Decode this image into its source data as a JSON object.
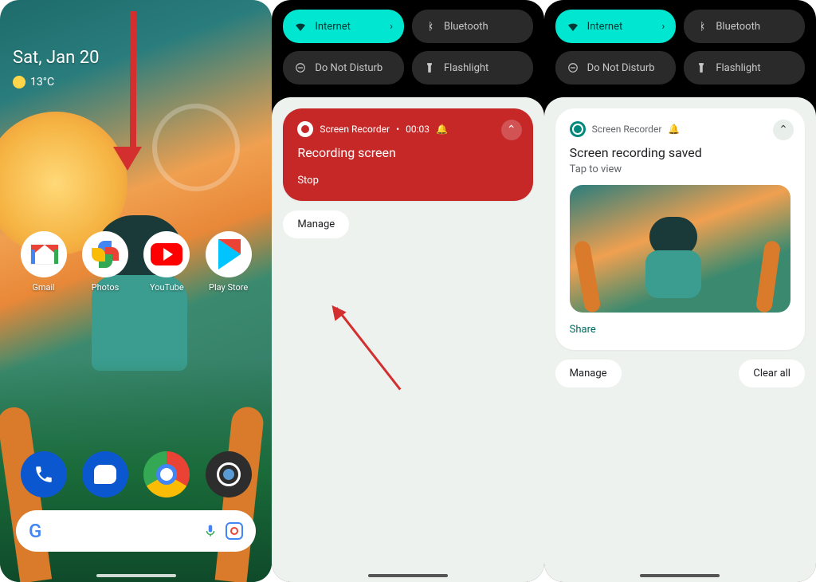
{
  "panel1": {
    "date": "Sat, Jan 20",
    "temperature": "13°C",
    "apps_row1": [
      {
        "label": "Gmail"
      },
      {
        "label": "Photos"
      },
      {
        "label": "YouTube"
      },
      {
        "label": "Play Store"
      }
    ]
  },
  "qs": {
    "internet": "Internet",
    "bluetooth": "Bluetooth",
    "dnd": "Do Not Disturb",
    "flashlight": "Flashlight"
  },
  "panel2": {
    "notif": {
      "app": "Screen Recorder",
      "time": "00:03",
      "title": "Recording screen",
      "action": "Stop"
    },
    "manage": "Manage"
  },
  "panel3": {
    "notif": {
      "app": "Screen Recorder",
      "title": "Screen recording saved",
      "sub": "Tap to view",
      "share": "Share"
    },
    "manage": "Manage",
    "clear_all": "Clear all"
  }
}
